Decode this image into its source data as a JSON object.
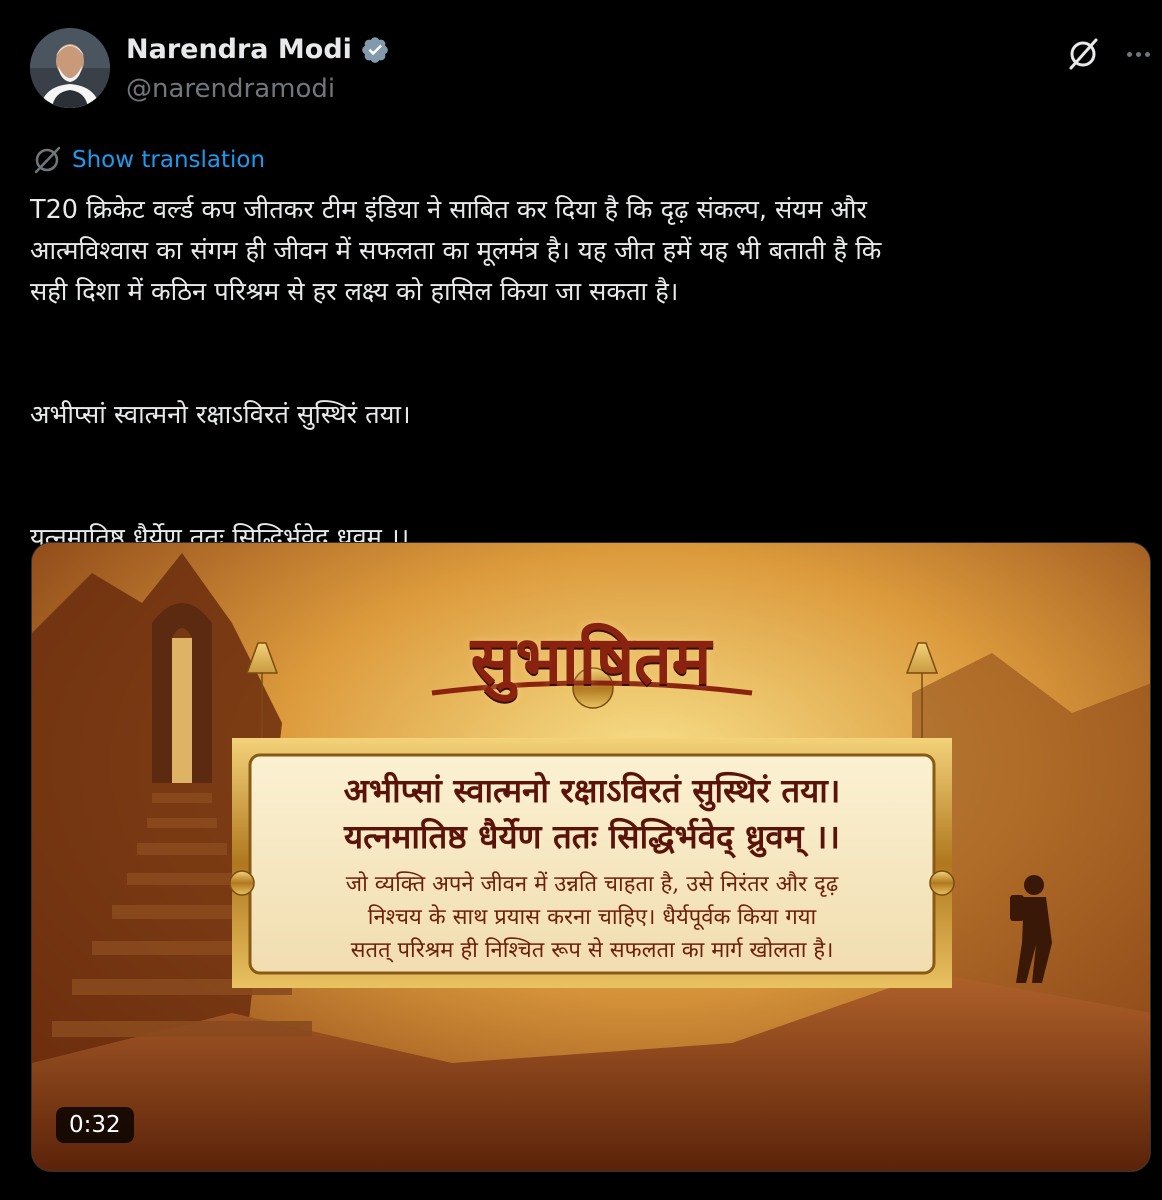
{
  "author": {
    "display_name": "Narendra Modi",
    "handle": "@narendramodi",
    "verified_color": "#829aab"
  },
  "actions": {
    "grok_icon": "grok-icon",
    "more_icon": "more-dots-icon"
  },
  "translation": {
    "label": "Show translation",
    "icon": "globe-icon",
    "accent": "#1d9bf0"
  },
  "tweet": {
    "lines": [
      "T20 क्रिकेट वर्ल्ड कप जीतकर टीम इंडिया ने साबित कर दिया है कि दृढ़ संकल्प, संयम और",
      "आत्मविश्वास का संगम ही जीवन में सफलता का मूलमंत्र है। यह जीत हमें यह भी बताती है कि",
      "सही दिशा में कठिन परिश्रम से हर लक्ष्य को हासिल किया जा सकता है।"
    ],
    "verse_line_1": "अभीप्सां स्वात्मनो रक्षाऽविरतं सुस्थिरं तया।",
    "verse_line_2": "यत्नमातिष्ठ धैर्येण ततः सिद्धिर्भवेद् ध्रुवम् ।।"
  },
  "media": {
    "title": "सुभाषितम",
    "shloka_line_1": "अभीप्सां स्वात्मनो रक्षाऽविरतं सुस्थिरं तया।",
    "shloka_line_2": "यत्नमातिष्ठ धैर्येण ततः सिद्धिर्भवेद् ध्रुवम् ।।",
    "meaning_lines": [
      "जो व्यक्ति अपने जीवन में उन्नति चाहता है, उसे निरंतर और दृढ़",
      "निश्चय के साथ प्रयास करना चाहिए। धैर्यपूर्वक किया गया",
      "सतत् परिश्रम ही निश्चित रूप से सफलता का मार्ग खोलता है।"
    ],
    "duration": "0:32"
  }
}
